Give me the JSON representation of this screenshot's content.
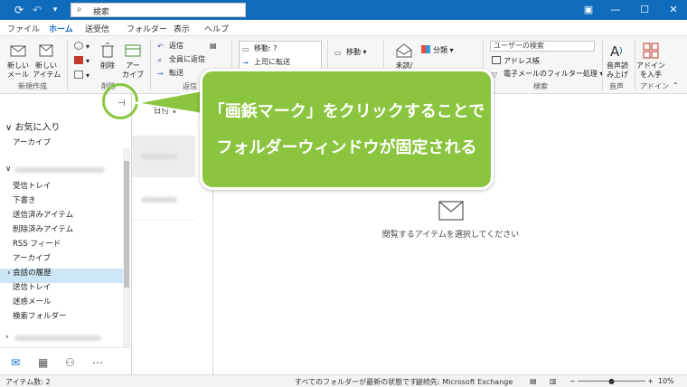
{
  "titlebar": {
    "search_placeholder": "検索",
    "accent": "#0f6cbd"
  },
  "tabs": [
    "ファイル",
    "ホーム",
    "送受信",
    "フォルダー",
    "表示",
    "ヘルプ"
  ],
  "active_tab": "ホーム",
  "ribbon": {
    "new_mail": "新しい\nメール",
    "new_items": "新しい\nアイテム",
    "group_new": "新規作成",
    "delete": "削除",
    "archive": "アー\nカイブ",
    "group_delete": "削除",
    "reply": "返信",
    "reply_all": "全員に返信",
    "forward": "転送",
    "group_respond": "返信",
    "move_to": "移動: ?",
    "to_manager": "上司に転送",
    "move": "移動",
    "categorize": "分類",
    "unread": "未読/",
    "user_search_placeholder": "ユーザーの検索",
    "address_book": "アドレス帳",
    "filter_email": "電子メールのフィルター処理",
    "group_search": "検索",
    "read_aloud": "音声読\nみ上げ",
    "group_voice": "音声",
    "get_addins": "アドイン\nを入手",
    "group_addins": "アドイン"
  },
  "folder_pane": {
    "favorites_header": "お気に入り",
    "favorites": [
      "アーカイブ"
    ],
    "folders": [
      "受信トレイ",
      "下書き",
      "送信済みアイテム",
      "削除済みアイテム",
      "RSS フィード",
      "アーカイブ"
    ],
    "history": "会話の履歴",
    "folders2": [
      "送信トレイ",
      "迷惑メール",
      "検索フォルダー"
    ],
    "selected": "受信トレイ"
  },
  "message_list": {
    "sort_label": "日付"
  },
  "reading_pane": {
    "empty_message": "閲覧するアイテムを選択してください"
  },
  "status_bar": {
    "item_count": "アイテム数: 2",
    "folders_status": "すべてのフォルダーが最新の状態です。",
    "connection": "接続先: Microsoft Exchange",
    "zoom": "10%"
  },
  "callout": {
    "line1": "「画鋲マーク」をクリックすることで",
    "line2": "フォルダーウィンドウが固定される",
    "color": "#8bc53f"
  }
}
